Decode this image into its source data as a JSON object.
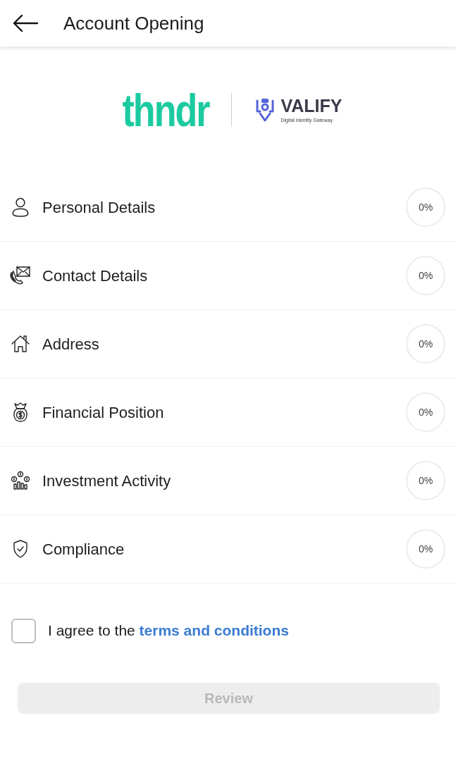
{
  "header": {
    "title": "Account Opening"
  },
  "logos": {
    "brand": "thndr",
    "partner": {
      "name": "VALIFY",
      "tagline": "Digital Identity Gateway"
    }
  },
  "sections": [
    {
      "kind": "person",
      "label": "Personal Details",
      "progress": "0%"
    },
    {
      "kind": "contact",
      "label": "Contact Details",
      "progress": "0%"
    },
    {
      "kind": "home",
      "label": "Address",
      "progress": "0%"
    },
    {
      "kind": "money",
      "label": "Financial Position",
      "progress": "0%"
    },
    {
      "kind": "investment",
      "label": "Investment Activity",
      "progress": "0%"
    },
    {
      "kind": "compliance",
      "label": "Compliance",
      "progress": "0%"
    }
  ],
  "agreement": {
    "checked": false,
    "text": "I agree to the",
    "link": "terms and conditions"
  },
  "review_button": {
    "label": "Review",
    "disabled": true
  }
}
